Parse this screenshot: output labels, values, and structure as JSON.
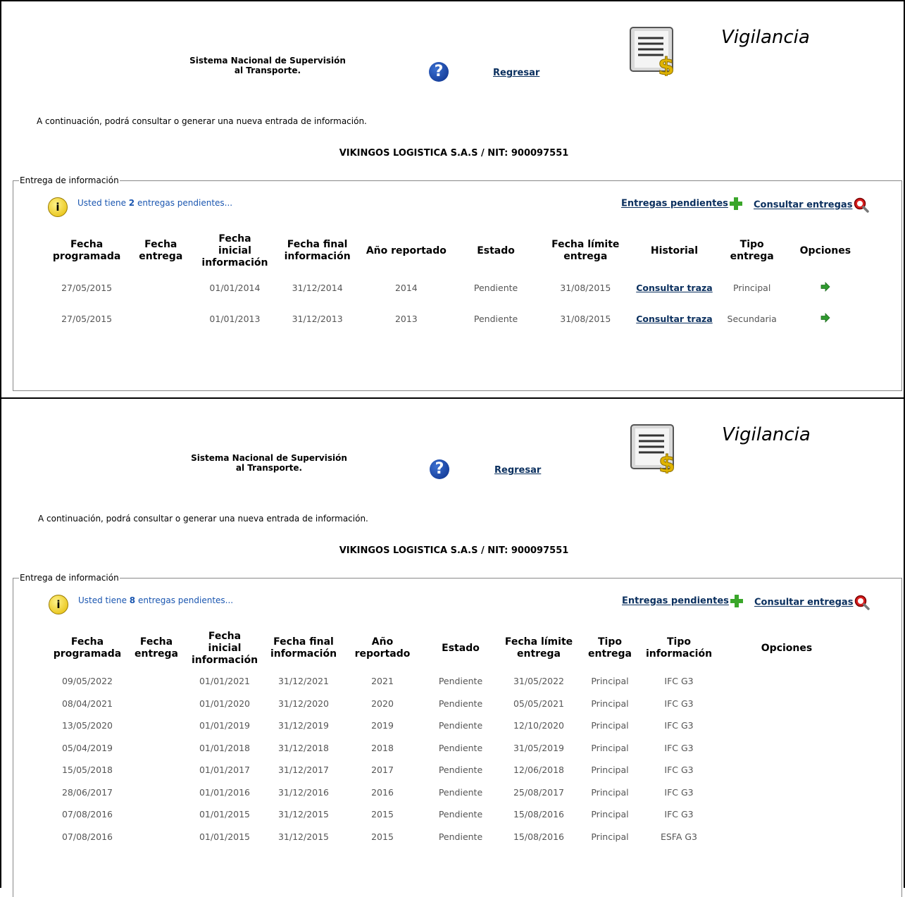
{
  "shared": {
    "system_title_line1": "Sistema Nacional de Supervisión",
    "system_title_line2": "al Transporte.",
    "help_glyph": "?",
    "back_link": "Regresar",
    "module_title": "Vigilancia",
    "intro_text": "A continuación, podrá consultar o generar una nueva entrada de información.",
    "company": "VIKINGOS LOGISTICA S.A.S / NIT: 900097551",
    "fieldset_legend": "Entrega de información",
    "info_glyph": "i",
    "pending_prefix": "Usted tiene",
    "pending_suffix": "entregas pendientes...",
    "link_pending": "Entregas pendientes",
    "link_consult": "Consultar entregas",
    "icons": [
      "help-icon",
      "document-dollar-icon",
      "info-icon",
      "plus-icon",
      "magnifier-icon",
      "arrow-right-icon"
    ],
    "colors": {
      "link": "#0a2f5e",
      "pending_text": "#1a56b0",
      "plus_green": "#3aa62a",
      "arrow_green": "#2f9a2f"
    }
  },
  "panel1": {
    "pending_count": "2",
    "columns": [
      [
        "Fecha",
        "programada"
      ],
      [
        "Fecha",
        "entrega"
      ],
      [
        "Fecha",
        "inicial",
        "información"
      ],
      [
        "Fecha final",
        "información"
      ],
      [
        "Año reportado"
      ],
      [
        "Estado"
      ],
      [
        "Fecha límite",
        "entrega"
      ],
      [
        "Historial"
      ],
      [
        "Tipo",
        "entrega"
      ],
      [
        "Opciones"
      ]
    ],
    "rows": [
      [
        "27/05/2015",
        "",
        "01/01/2014",
        "31/12/2014",
        "2014",
        "Pendiente",
        "31/08/2015",
        "Consultar traza",
        "Principal"
      ],
      [
        "27/05/2015",
        "",
        "01/01/2013",
        "31/12/2013",
        "2013",
        "Pendiente",
        "31/08/2015",
        "Consultar traza",
        "Secundaria"
      ]
    ]
  },
  "panel2": {
    "pending_count": "8",
    "columns": [
      [
        "Fecha",
        "programada"
      ],
      [
        "Fecha",
        "entrega"
      ],
      [
        "Fecha",
        "inicial",
        "información"
      ],
      [
        "Fecha final",
        "información"
      ],
      [
        "Año",
        "reportado"
      ],
      [
        "Estado"
      ],
      [
        "Fecha límite",
        "entrega"
      ],
      [
        "Tipo",
        "entrega"
      ],
      [
        "Tipo",
        "información"
      ],
      [
        "Opciones"
      ]
    ],
    "rows": [
      [
        "09/05/2022",
        "",
        "01/01/2021",
        "31/12/2021",
        "2021",
        "Pendiente",
        "31/05/2022",
        "Principal",
        "IFC G3",
        ""
      ],
      [
        "08/04/2021",
        "",
        "01/01/2020",
        "31/12/2020",
        "2020",
        "Pendiente",
        "05/05/2021",
        "Principal",
        "IFC G3",
        ""
      ],
      [
        "13/05/2020",
        "",
        "01/01/2019",
        "31/12/2019",
        "2019",
        "Pendiente",
        "12/10/2020",
        "Principal",
        "IFC G3",
        ""
      ],
      [
        "05/04/2019",
        "",
        "01/01/2018",
        "31/12/2018",
        "2018",
        "Pendiente",
        "31/05/2019",
        "Principal",
        "IFC G3",
        ""
      ],
      [
        "15/05/2018",
        "",
        "01/01/2017",
        "31/12/2017",
        "2017",
        "Pendiente",
        "12/06/2018",
        "Principal",
        "IFC G3",
        ""
      ],
      [
        "28/06/2017",
        "",
        "01/01/2016",
        "31/12/2016",
        "2016",
        "Pendiente",
        "25/08/2017",
        "Principal",
        "IFC G3",
        ""
      ],
      [
        "07/08/2016",
        "",
        "01/01/2015",
        "31/12/2015",
        "2015",
        "Pendiente",
        "15/08/2016",
        "Principal",
        "IFC G3",
        ""
      ],
      [
        "07/08/2016",
        "",
        "01/01/2015",
        "31/12/2015",
        "2015",
        "Pendiente",
        "15/08/2016",
        "Principal",
        "ESFA G3",
        ""
      ]
    ]
  }
}
